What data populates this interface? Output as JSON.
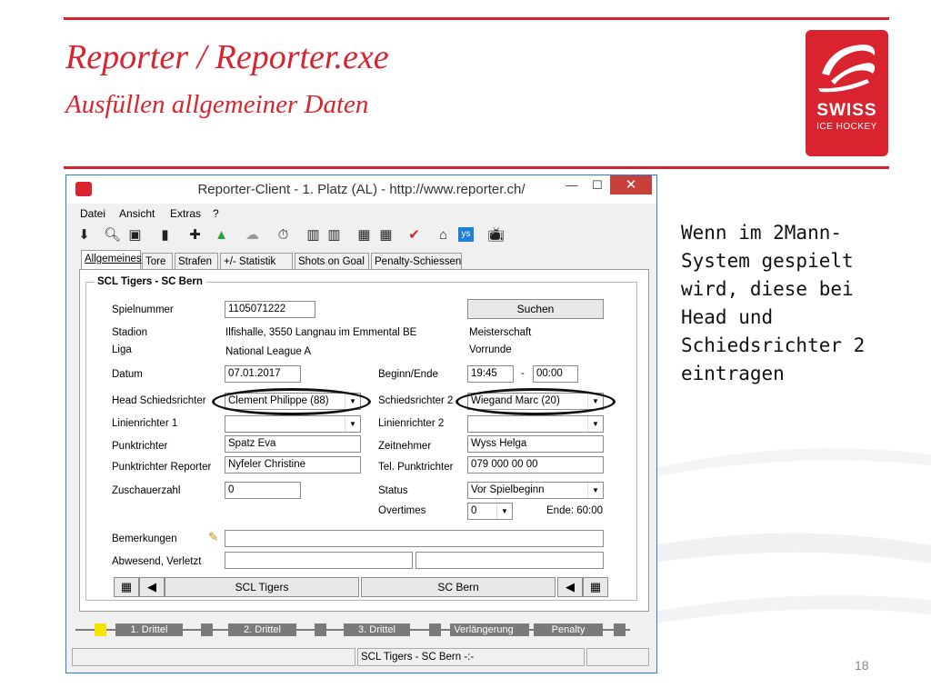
{
  "slide": {
    "title": "Reporter / Reporter.exe",
    "subtitle": "Ausfüllen allgemeiner Daten",
    "note": "Wenn im 2Mann-\nSystem gespielt\nwird, diese bei\nHead und\nSchiedsrichter 2\neintragen",
    "page_number": "18",
    "logo_line1": "SWISS",
    "logo_line2": "ICE HOCKEY",
    "brand_color": "#d9232e"
  },
  "window": {
    "title": "Reporter-Client  -  1. Platz (AL)  -  http://www.reporter.ch/",
    "minimize": "—",
    "maximize": "☐",
    "close": "✕"
  },
  "menu": [
    "Datei",
    "Ansicht",
    "Extras",
    "?"
  ],
  "toolbar": {
    "icons": [
      "download-icon",
      "search-icon",
      "save-icon",
      "clipboard-icon",
      "player-add-icon",
      "upload-icon",
      "cloud-icon",
      "stopwatch-icon",
      "lineup-icon",
      "lineup-icon",
      "team-icon",
      "team-icon",
      "checkmark-icon",
      "home-icon",
      "ys-icon",
      "tv-icon"
    ],
    "ys_label": "ys"
  },
  "tabs": [
    "Allgemeines",
    "Tore",
    "Strafen",
    "+/- Statistik",
    "Shots on Goal",
    "Penalty-Schiessen"
  ],
  "form": {
    "group_title": "SCL Tigers - SC Bern",
    "spielnummer_label": "Spielnummer",
    "spielnummer_value": "1105071222",
    "suchen_button": "Suchen",
    "stadion_label": "Stadion",
    "stadion_value": "Ilfishalle, 3550 Langnau im Emmental BE",
    "meisterschaft": "Meisterschaft",
    "liga_label": "Liga",
    "liga_value": "National League A",
    "vorrunde": "Vorrunde",
    "datum_label": "Datum",
    "datum_value": "07.01.2017",
    "beginn_label": "Beginn/Ende",
    "beginn_value": "19:45",
    "dash": "-",
    "ende_value": "00:00",
    "head_sr_label": "Head Schiedsrichter",
    "head_sr_value": "Clement Philippe (88)",
    "sr2_label": "Schiedsrichter 2",
    "sr2_value": "Wiegand Marc (20)",
    "linien1_label": "Linienrichter 1",
    "linien1_value": "",
    "linien2_label": "Linienrichter 2",
    "linien2_value": "",
    "punktrichter_label": "Punktrichter",
    "punktrichter_value": "Spatz Eva",
    "zeitnehmer_label": "Zeitnehmer",
    "zeitnehmer_value": "Wyss Helga",
    "pr_reporter_label": "Punktrichter Reporter",
    "pr_reporter_value": "Nyfeler Christine",
    "tel_label": "Tel. Punktrichter",
    "tel_value": "079 000 00 00",
    "zuschauer_label": "Zuschauerzahl",
    "zuschauer_value": "0",
    "status_label": "Status",
    "status_value": "Vor Spielbeginn",
    "overtimes_label": "Overtimes",
    "overtimes_value": "0",
    "ende_label": "Ende: 60:00",
    "bemerkungen_label": "Bemerkungen",
    "bemerkungen_value": "",
    "abwesend_label": "Abwesend, Verletzt",
    "abwesend_value1": "",
    "abwesend_value2": ""
  },
  "teams": {
    "home": "SCL Tigers",
    "away": "SC Bern"
  },
  "periods": [
    "1. Drittel",
    "2. Drittel",
    "3. Drittel",
    "Verlängerung",
    "Penalty"
  ],
  "statusbar": {
    "score": "SCL Tigers - SC Bern -:-"
  }
}
